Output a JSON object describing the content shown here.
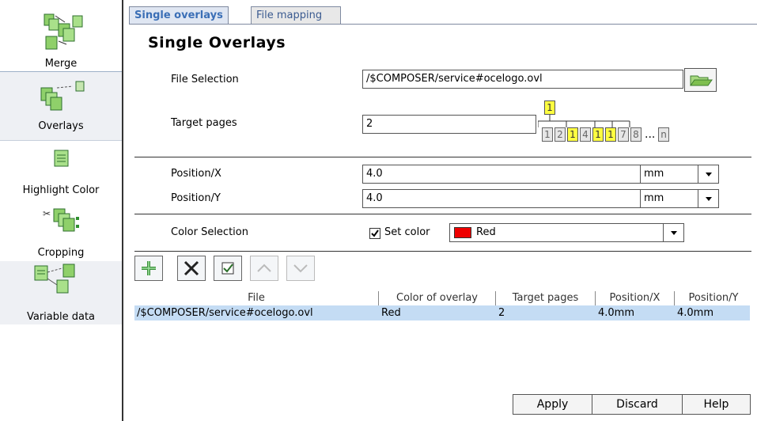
{
  "sidebar": {
    "items": [
      {
        "label": "Merge",
        "icon": "merge-icon"
      },
      {
        "label": "Overlays",
        "icon": "overlays-icon"
      },
      {
        "label": "Highlight Color",
        "icon": "highlight-color-icon"
      },
      {
        "label": "Cropping",
        "icon": "cropping-icon"
      },
      {
        "label": "Variable data",
        "icon": "variable-data-icon"
      }
    ],
    "selected": "Overlays"
  },
  "tabs": [
    {
      "label": "Single overlays",
      "active": true
    },
    {
      "label": "File mapping",
      "active": false
    }
  ],
  "page_title": "Single Overlays",
  "form": {
    "file_selection": {
      "label": "File Selection",
      "value": "/$COMPOSER/service#ocelogo.ovl",
      "browse_icon": "folder-open-icon"
    },
    "target_pages": {
      "label": "Target pages",
      "value": "2",
      "diagram": {
        "top": "1",
        "pages": [
          "1",
          "2",
          "1",
          "4",
          "1",
          "1",
          "7",
          "8"
        ],
        "ellipsis": "...",
        "last": "n"
      }
    },
    "position_x": {
      "label": "Position/X",
      "value": "4.0",
      "unit": "mm"
    },
    "position_y": {
      "label": "Position/Y",
      "value": "4.0",
      "unit": "mm"
    },
    "color_selection": {
      "label": "Color Selection",
      "checkbox_label": "Set color",
      "checked": true,
      "color_name": "Red",
      "swatch_color": "#ee0000"
    }
  },
  "toolbar": {
    "add_icon": "plus-icon",
    "remove_icon": "x-icon",
    "check_icon": "checkbox-icon",
    "up_icon": "chevron-up-icon",
    "down_icon": "chevron-down-icon"
  },
  "table": {
    "columns": [
      "File",
      "Color of overlay",
      "Target pages",
      "Position/X",
      "Position/Y"
    ],
    "rows": [
      [
        "/$COMPOSER/service#ocelogo.ovl",
        "Red",
        "2",
        "4.0mm",
        "4.0mm"
      ]
    ]
  },
  "buttons": {
    "apply": "Apply",
    "discard": "Discard",
    "help": "Help"
  },
  "colors": {
    "tab_active_text": "#3b6fb6",
    "row_selected": "#c4dcf4",
    "page_highlight": "#ffff40",
    "folder_green": "#7fbf4f"
  }
}
